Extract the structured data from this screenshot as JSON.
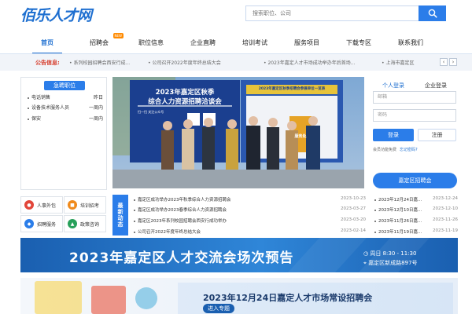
{
  "header": {
    "logo": "佰乐人才网",
    "search_placeholder": "搜索职位、公司"
  },
  "nav": [
    {
      "label": "首页",
      "active": true
    },
    {
      "label": "招聘会",
      "badge": "NEW"
    },
    {
      "label": "职位信息"
    },
    {
      "label": "企业直聘"
    },
    {
      "label": "培训考试"
    },
    {
      "label": "服务项目"
    },
    {
      "label": "下载专区"
    },
    {
      "label": "联系我们"
    }
  ],
  "notice": {
    "label": "公告信息:",
    "items": [
      "系列校园招聘会西安行成...",
      "公司召开2022年度年终总结大会",
      "2023年嘉定人才市场成功举办年后首场...",
      "上海市嘉定区"
    ]
  },
  "urgent": {
    "title": "急聘职位",
    "rows": [
      {
        "job": "电话销售",
        "when": "昨日"
      },
      {
        "job": "设备技术服务人员",
        "when": "一周内"
      },
      {
        "job": "保安",
        "when": "一周内"
      }
    ]
  },
  "photo": {
    "line1": "2023年嘉定区秋季",
    "line2": "综合人力资源招聘洽谈会",
    "right_title": "2023年嘉定区秋季招聘会参展单位一览表",
    "qr_text": "扫一扫 关注公众号",
    "sign": "服务处"
  },
  "login": {
    "tab_personal": "个人登录",
    "tab_company": "企业登录",
    "email_placeholder": "邮箱",
    "password_placeholder": "密码",
    "login_btn": "登录",
    "register_btn": "注册",
    "free_register": "会员功能免费",
    "forgot": "忘记密码?",
    "jiading_btn": "嘉定区招聘会"
  },
  "services": [
    {
      "label": "人事外包",
      "color": "#e2463a",
      "icon": "person-icon"
    },
    {
      "label": "培训招考",
      "color": "#f08a1c",
      "icon": "book-icon"
    },
    {
      "label": "招聘服务",
      "color": "#2b7de9",
      "icon": "megaphone-icon"
    },
    {
      "label": "政策咨询",
      "color": "#27a05a",
      "icon": "chat-icon"
    }
  ],
  "news": {
    "tag": "最新动态",
    "rows": [
      {
        "title": "嘉定区成功举办2023年秋季综合人力资源招聘会",
        "date": "2023-10-23"
      },
      {
        "title": "嘉定区成功举办2023春季综合人力资源招聘会",
        "date": "2023-03-27"
      },
      {
        "title": "嘉定区2023年系列校园招聘会西安行成功举办",
        "date": "2023-03-20"
      },
      {
        "title": "公司召开2022年度年终总结大会",
        "date": "2023-02-14"
      }
    ],
    "right_rows": [
      {
        "title": "2023年12月24日嘉...",
        "date": "2023-12-24"
      },
      {
        "title": "2023年12月10日嘉...",
        "date": "2023-12-10"
      },
      {
        "title": "2023年11月26日嘉...",
        "date": "2023-11-26"
      },
      {
        "title": "2023年11月19日嘉...",
        "date": "2023-11-19"
      }
    ]
  },
  "banner1": {
    "title": "2023年嘉定区人才交流会场次预告",
    "time": "周日  8:30 - 11:30",
    "address": "嘉定区新成路897号"
  },
  "banner2": {
    "title": "2023年12月24日嘉定人才市场常设招聘会",
    "sub": "进入专题"
  }
}
